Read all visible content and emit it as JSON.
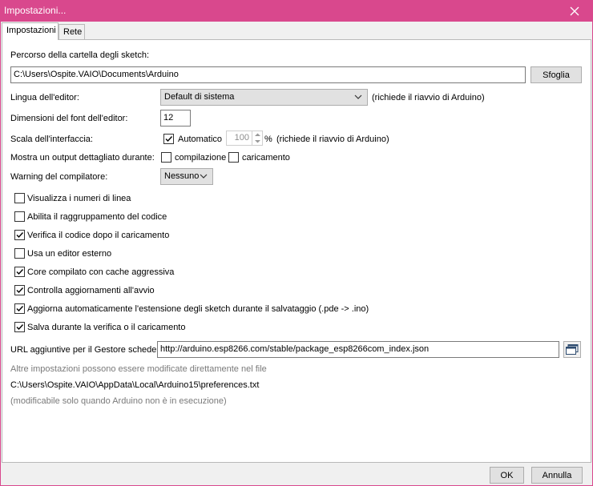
{
  "window": {
    "title": "Impostazioni..."
  },
  "tabs": [
    {
      "label": "Impostazioni"
    },
    {
      "label": "Rete"
    }
  ],
  "sketch_folder": {
    "label": "Percorso della cartella degli sketch:",
    "value": "C:\\Users\\Ospite.VAIO\\Documents\\Arduino",
    "browse_label": "Sfoglia"
  },
  "editor_language": {
    "label": "Lingua dell'editor:",
    "selected": "Default di sistema",
    "note": "(richiede il riavvio di Arduino)"
  },
  "font_size": {
    "label": "Dimensioni del font dell'editor:",
    "value": "12"
  },
  "ui_scale": {
    "label": "Scala dell'interfaccia:",
    "auto_label": "Automatico",
    "auto_checked": true,
    "value": "100",
    "unit": "%",
    "note": "(richiede il riavvio di Arduino)"
  },
  "verbose": {
    "label": "Mostra un output dettagliato durante:",
    "compile_label": "compilazione",
    "compile_checked": false,
    "upload_label": "caricamento",
    "upload_checked": false
  },
  "warnings": {
    "label": "Warning del compilatore:",
    "selected": "Nessuno"
  },
  "options": [
    {
      "label": "Visualizza i numeri di linea",
      "checked": false
    },
    {
      "label": "Abilita il raggruppamento del codice",
      "checked": false
    },
    {
      "label": "Verifica il codice dopo il caricamento",
      "checked": true
    },
    {
      "label": "Usa un editor esterno",
      "checked": false
    },
    {
      "label": "Core compilato con cache aggressiva",
      "checked": true
    },
    {
      "label": "Controlla aggiornamenti all'avvio",
      "checked": true
    },
    {
      "label": "Aggiorna automaticamente l'estensione degli sketch durante il salvataggio (.pde -> .ino)",
      "checked": true
    },
    {
      "label": "Salva durante la verifica o il caricamento",
      "checked": true
    }
  ],
  "board_urls": {
    "label": "URL aggiuntive per il Gestore schede:",
    "value": "http://arduino.esp8266.com/stable/package_esp8266com_index.json"
  },
  "more_prefs": {
    "info": "Altre impostazioni possono essere modificate direttamente nel file",
    "path": "C:\\Users\\Ospite.VAIO\\AppData\\Local\\Arduino15\\preferences.txt",
    "note": "(modificabile solo quando Arduino non è in esecuzione)"
  },
  "footer": {
    "ok_label": "OK",
    "cancel_label": "Annulla"
  }
}
